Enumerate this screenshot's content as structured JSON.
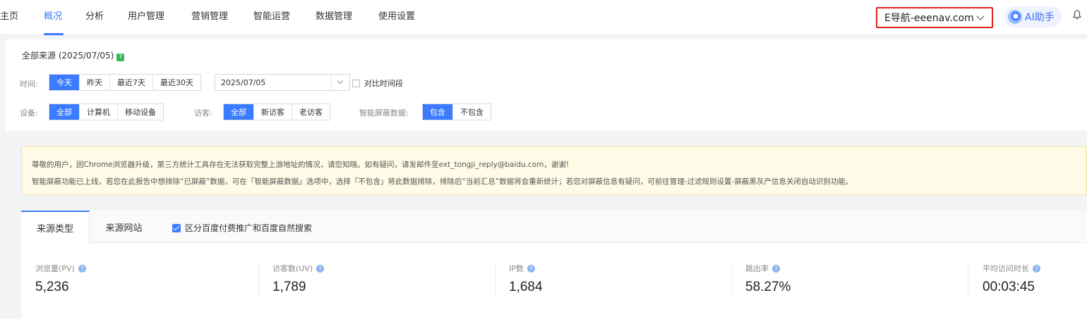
{
  "topnav": {
    "items": [
      "主页",
      "概况",
      "分析",
      "用户管理",
      "营销管理",
      "智能运营",
      "数据管理",
      "使用设置"
    ],
    "active_index": 1,
    "site_selector": "E导航-eeenav.com",
    "ai_button": "AI助手",
    "icons": {
      "ai": "ai-assistant-icon",
      "bell": "bell-icon",
      "dropdown": "chevron-down-icon"
    }
  },
  "filters": {
    "title": "全部来源 (2025/07/05)",
    "time_label": "时间:",
    "time_options": [
      "今天",
      "昨天",
      "最近7天",
      "最近30天"
    ],
    "time_active": 0,
    "date_value": "2025/07/05",
    "compare_label": "对比时间段",
    "device_label": "设备:",
    "device_options": [
      "全部",
      "计算机",
      "移动设备"
    ],
    "device_active": 0,
    "visitor_label": "访客:",
    "visitor_options": [
      "全部",
      "新访客",
      "老访客"
    ],
    "visitor_active": 0,
    "smart_label": "智能屏蔽数据:",
    "smart_options": [
      "包含",
      "不包含"
    ],
    "smart_active": 0
  },
  "notice": {
    "line1": "尊敬的用户，因Chrome浏览器升级，第三方统计工具存在无法获取完整上游地址的情况，请您知晓。如有疑问，请发邮件至ext_tongji_reply@baidu.com，谢谢!",
    "line2": "智能屏蔽功能已上线，若您在此报告中想排除“已屏蔽”数据，可在「智能屏蔽数据」选项中，选择「不包含」将此数据排除，排除后“当前汇总”数据将会重新统计；若您对屏蔽信息有疑问，可前往管理-过滤规则设置-屏蔽黑灰产信息关闭自动识别功能。"
  },
  "data_panel": {
    "tabs": [
      "来源类型",
      "来源网站"
    ],
    "active_tab": 0,
    "checkbox_label": "区分百度付费推广和百度自然搜索",
    "checkbox_checked": true,
    "metrics": [
      {
        "label": "浏览量(PV)",
        "value": "5,236"
      },
      {
        "label": "访客数(UV)",
        "value": "1,789"
      },
      {
        "label": "IP数",
        "value": "1,684"
      },
      {
        "label": "跳出率",
        "value": "58.27%"
      },
      {
        "label": "平均访问时长",
        "value": "00:03:45"
      }
    ]
  },
  "colors": {
    "accent": "#3b7bff",
    "highlight_border": "#d9241f",
    "notice_bg": "#fffbe6",
    "help_badge": "#3cb55a"
  }
}
